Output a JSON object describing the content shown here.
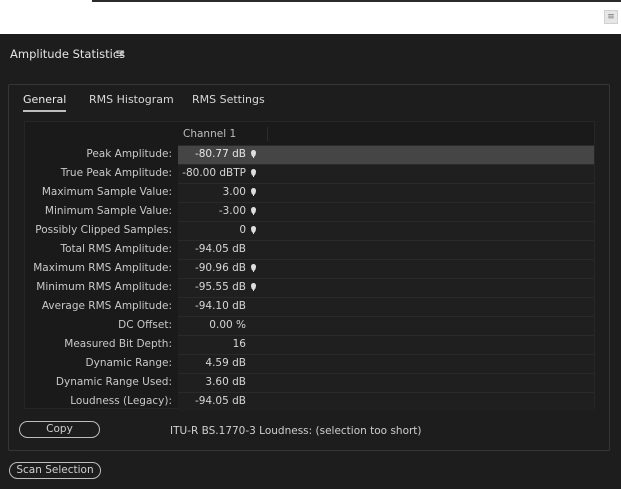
{
  "panel": {
    "title": "Amplitude Statistics",
    "menu_icon": "hamburger-menu-icon"
  },
  "tabs": [
    {
      "label": "General",
      "active": true
    },
    {
      "label": "RMS Histogram",
      "active": false
    },
    {
      "label": "RMS Settings",
      "active": false
    }
  ],
  "table": {
    "column_header": "Channel 1",
    "rows": [
      {
        "label": "Peak Amplitude:",
        "value": "-80.77 dB",
        "marker": true,
        "selected": true
      },
      {
        "label": "True Peak Amplitude:",
        "value": "-80.00 dBTP",
        "marker": true,
        "selected": false
      },
      {
        "label": "Maximum Sample Value:",
        "value": "3.00",
        "marker": true,
        "selected": false
      },
      {
        "label": "Minimum Sample Value:",
        "value": "-3.00",
        "marker": true,
        "selected": false
      },
      {
        "label": "Possibly Clipped Samples:",
        "value": "0",
        "marker": true,
        "selected": false
      },
      {
        "label": "Total RMS Amplitude:",
        "value": "-94.05 dB",
        "marker": false,
        "selected": false
      },
      {
        "label": "Maximum RMS Amplitude:",
        "value": "-90.96 dB",
        "marker": true,
        "selected": false
      },
      {
        "label": "Minimum RMS Amplitude:",
        "value": "-95.55 dB",
        "marker": true,
        "selected": false
      },
      {
        "label": "Average RMS Amplitude:",
        "value": "-94.10 dB",
        "marker": false,
        "selected": false
      },
      {
        "label": "DC Offset:",
        "value": "0.00 %",
        "marker": false,
        "selected": false
      },
      {
        "label": "Measured Bit Depth:",
        "value": "16",
        "marker": false,
        "selected": false
      },
      {
        "label": "Dynamic Range:",
        "value": "4.59 dB",
        "marker": false,
        "selected": false
      },
      {
        "label": "Dynamic Range Used:",
        "value": "3.60 dB",
        "marker": false,
        "selected": false
      },
      {
        "label": "Loudness (Legacy):",
        "value": "-94.05 dB",
        "marker": false,
        "selected": false
      }
    ]
  },
  "copy_button": "Copy",
  "loudness_text": "ITU-R BS.1770-3 Loudness:  (selection too short)",
  "scan_button": "Scan Selection"
}
